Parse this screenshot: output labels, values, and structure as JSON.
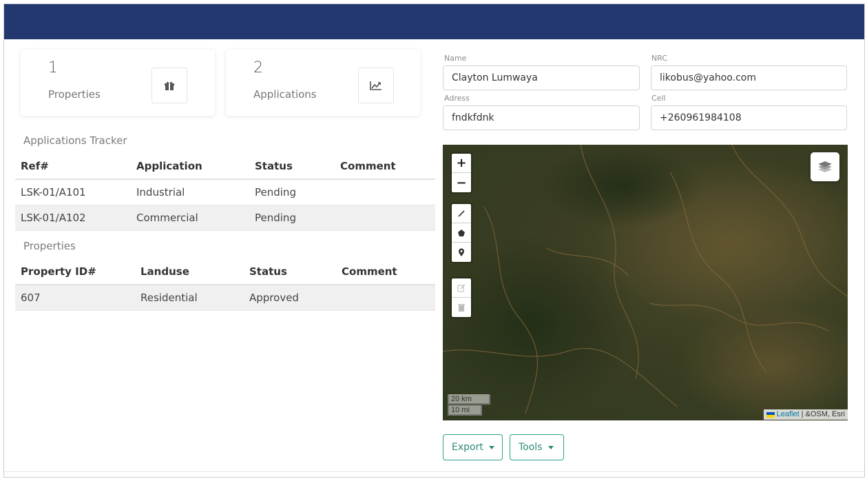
{
  "stats": [
    {
      "value": "1",
      "label": "Properties",
      "icon": "gift-icon"
    },
    {
      "value": "2",
      "label": "Applications",
      "icon": "chart-line-icon"
    }
  ],
  "applications": {
    "title": "Applications Tracker",
    "columns": [
      "Ref#",
      "Application",
      "Status",
      "Comment"
    ],
    "rows": [
      [
        "LSK-01/A101",
        "Industrial",
        "Pending",
        ""
      ],
      [
        "LSK-01/A102",
        "Commercial",
        "Pending",
        ""
      ]
    ]
  },
  "properties": {
    "title": "Properties",
    "columns": [
      "Property ID#",
      "Landuse",
      "Status",
      "Comment"
    ],
    "rows": [
      [
        "607",
        "Residential",
        "Approved",
        ""
      ]
    ]
  },
  "form": {
    "name_label": "Name",
    "name_value": "Clayton Lumwaya",
    "nrc_label": "NRC",
    "nrc_value": "likobus@yahoo.com",
    "address_label": "Adress",
    "address_value": "fndkfdnk",
    "cell_label": "Cell",
    "cell_value": "+260961984108"
  },
  "map": {
    "zoom_in": "+",
    "zoom_out": "−",
    "scale_km": "20 km",
    "scale_mi": "10 mi",
    "attribution_link": "Leaflet",
    "attribution_text": "| &OSM, Esri"
  },
  "buttons": {
    "export": "Export",
    "tools": "Tools"
  },
  "colors": {
    "header": "#243870",
    "accent": "#2aa088"
  }
}
